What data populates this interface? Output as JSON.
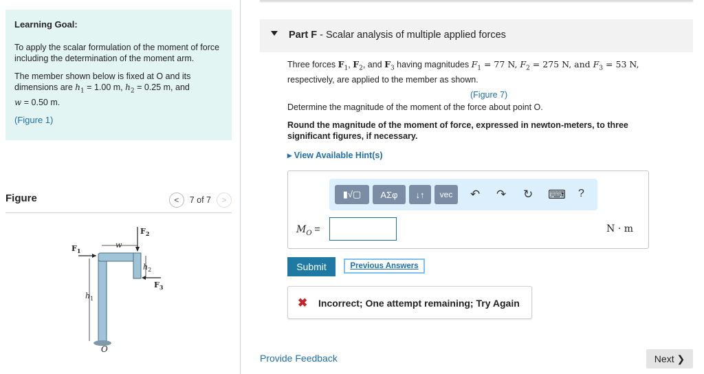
{
  "learning_goal": {
    "title": "Learning Goal:",
    "paragraph1": "To apply the scalar formulation of the moment of force including the determination of the moment arm.",
    "paragraph2_prefix": "The member shown below is fixed at O and its dimensions are ",
    "h1_label": "h",
    "h1_value": " = 1.00 m, ",
    "h2_label": "h",
    "h2_value": " = 0.25 m, and",
    "w_label": "w",
    "w_value": " = 0.50 m.",
    "figure_link": "(Figure 1)"
  },
  "figure_panel": {
    "title": "Figure",
    "prev_icon": "<",
    "pager_text": "7 of 7",
    "next_icon": ">",
    "labels": {
      "f1": "F",
      "f1_sub": "1",
      "f2": "F",
      "f2_sub": "2",
      "f3": "F",
      "f3_sub": "3",
      "w": "w",
      "h1": "h",
      "h1_sub": "1",
      "h2": "h",
      "h2_sub": "2",
      "o": "O"
    }
  },
  "part": {
    "label": "Part F",
    "title": " - Scalar analysis of multiple applied forces"
  },
  "question": {
    "line1_prefix": "Three forces ",
    "f1": "F",
    "f1_sub": "1",
    "f2": "F",
    "f2_sub": "2",
    "and": ", and ",
    "f3": "F",
    "f3_sub": "3",
    "having": " having magnitudes ",
    "mag1": " = 77 N, ",
    "mag2": " = 275 N, and ",
    "mag3": " = 53 N,",
    "line2": "respectively, are applied to the member as shown.",
    "figure_link": "(Figure 7)",
    "determine": "Determine the magnitude of the moment of the force about point O.",
    "round": "Round the magnitude of the moment of force, expressed in newton-meters, to three significant figures, if necessary.",
    "hint": "View Available Hint(s)"
  },
  "toolbar": {
    "templates_label": "▮√▢",
    "greek_label": "ΑΣφ",
    "updown_label": "↓↑",
    "vec_label": "vec",
    "undo_icon": "↶",
    "redo_icon": "↷",
    "reset_icon": "↻",
    "keyboard_icon": "⌨",
    "help_label": "?"
  },
  "answer": {
    "var": "M",
    "var_sub": "O",
    "eq": " =",
    "value": "",
    "unit": "N · m"
  },
  "buttons": {
    "submit": "Submit",
    "previous": "Previous Answers",
    "next": "Next ❯",
    "provide_feedback": "Provide Feedback"
  },
  "feedback": {
    "icon": "✖",
    "text": "Incorrect; One attempt remaining; Try Again"
  }
}
